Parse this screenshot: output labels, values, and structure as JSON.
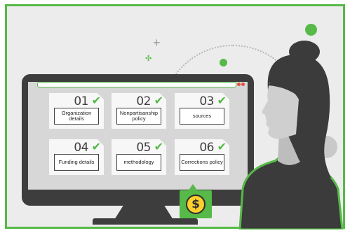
{
  "cards": [
    {
      "number": "01",
      "check": "✔",
      "label": "Organization details"
    },
    {
      "number": "02",
      "check": "✔",
      "label": "Nonpartisanship policy"
    },
    {
      "number": "03",
      "check": "✔",
      "label": "sources"
    },
    {
      "number": "04",
      "check": "✔",
      "label": "Funding details"
    },
    {
      "number": "05",
      "check": "✔",
      "label": "methodology"
    },
    {
      "number": "06",
      "check": "✔",
      "label": "Corrections policy"
    }
  ],
  "coin": {
    "symbol": "$"
  },
  "colors": {
    "accent_green": "#56b948",
    "monitor_dark": "#3d3d3d",
    "background": "#ececec",
    "card": "#f7f7f7",
    "coin": "#ffcf2e",
    "window_dot": "#e0523e"
  },
  "icons": [
    "checkmark-icon",
    "dollar-coin-icon",
    "sparkle-icon"
  ]
}
